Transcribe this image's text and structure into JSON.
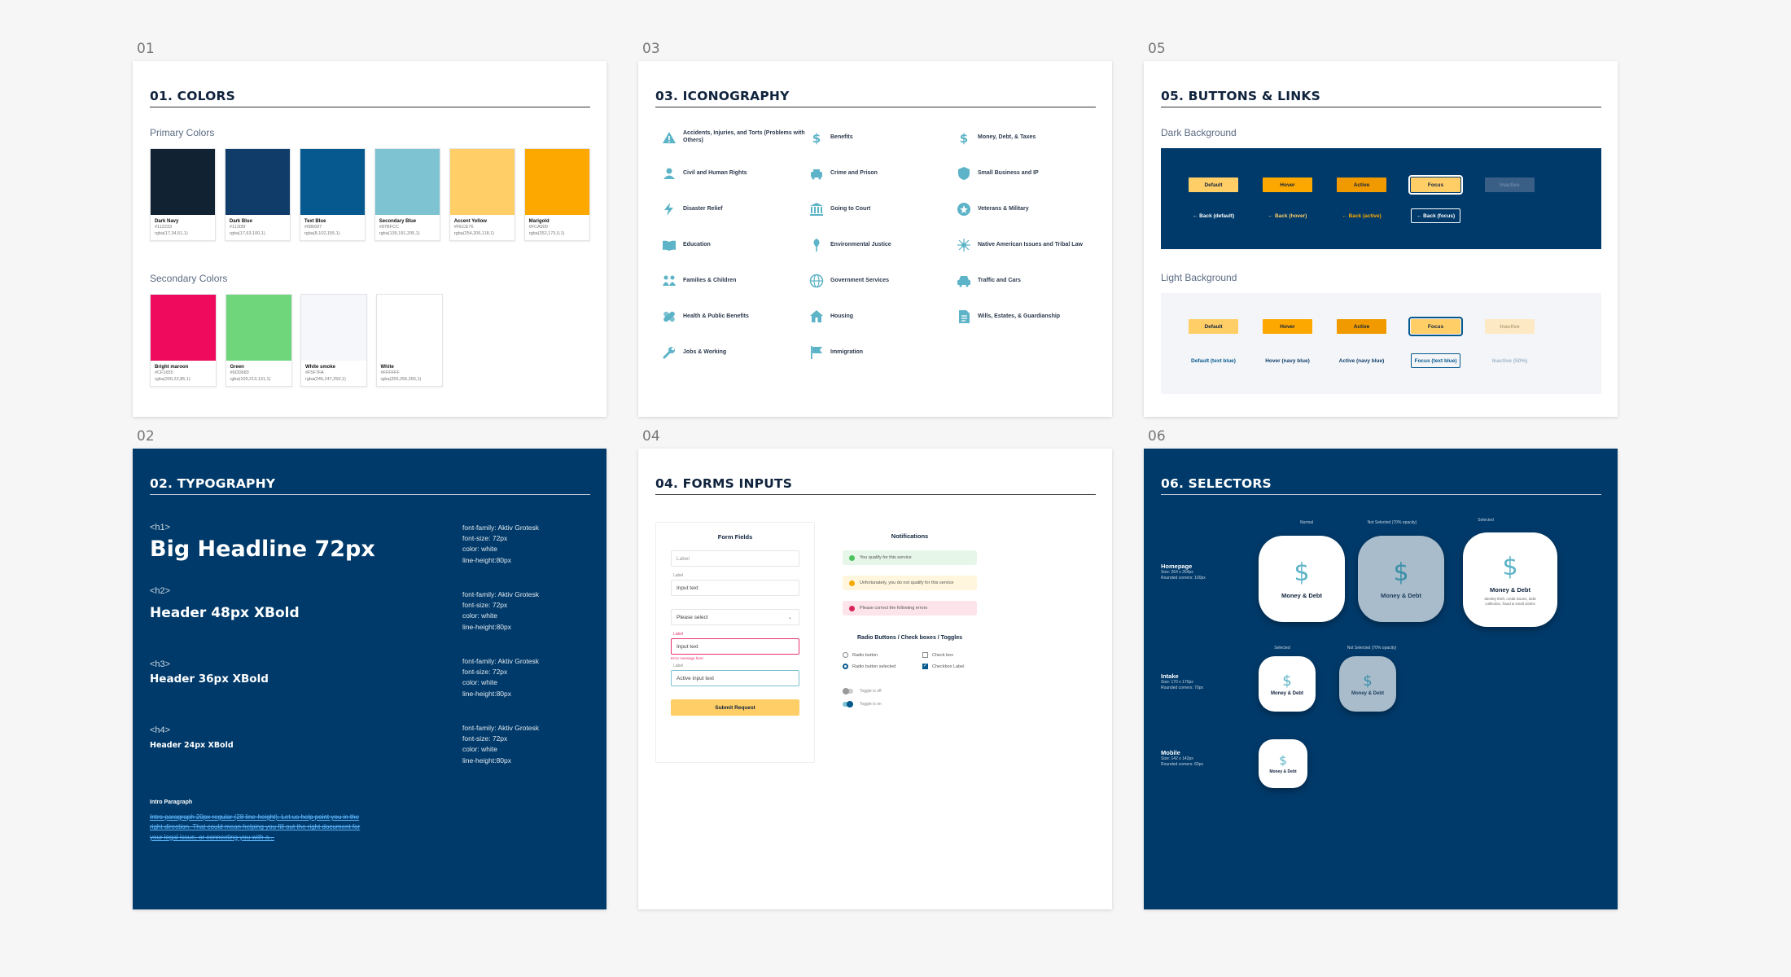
{
  "sections": {
    "colors": {
      "number": "01",
      "title": "01. COLORS",
      "primary_label": "Primary Colors",
      "secondary_label": "Secondary Colors",
      "primary": [
        {
          "name": "Dark Navy",
          "hex": "#112233",
          "rgba": "rgba(17,34,51,1)",
          "color": "#112233"
        },
        {
          "name": "Dark Blue",
          "hex": "#11305f",
          "rgba": "rgba(17,63,100,1)",
          "color": "#0f3c68"
        },
        {
          "name": "Text Blue",
          "hex": "#086697",
          "rgba": "rgba(8,102,155,1)",
          "color": "#05598f"
        },
        {
          "name": "Secondary Blue",
          "hex": "#87BFCC",
          "rgba": "rgba(135,191,205,1)",
          "color": "#7ec3d2"
        },
        {
          "name": "Accent Yellow",
          "hex": "#FECE76",
          "rgba": "rgba(254,206,118,1)",
          "color": "#ffce66"
        },
        {
          "name": "Marigold",
          "hex": "#FCA900",
          "rgba": "rgba(252,173,0,1)",
          "color": "#fda800"
        }
      ],
      "secondary": [
        {
          "name": "Bright maroon",
          "hex": "#CF1655",
          "rgba": "rgba(200,22,85,1)",
          "color": "#ef0a5e"
        },
        {
          "name": "Green",
          "hex": "#6DD683",
          "rgba": "rgba(109,213,131,1)",
          "color": "#70d67c"
        },
        {
          "name": "White smoke",
          "hex": "#F5F7FA",
          "rgba": "rgba(245,247,250,1)",
          "color": "#f5f7fa"
        },
        {
          "name": "White",
          "hex": "#FFFFFF",
          "rgba": "rgba(255,255,255,1)",
          "color": "#ffffff"
        }
      ]
    },
    "typography": {
      "number": "02",
      "title": "02. TYPOGRAPHY",
      "items": [
        {
          "tag": "<h1>",
          "text": "Big Headline 72px",
          "spec": [
            "font-family: Aktiv Grotesk",
            "font-size: 72px",
            "color: white",
            "line-height:80px"
          ]
        },
        {
          "tag": "<h2>",
          "text": "Header 48px XBold",
          "spec": [
            "font-family: Aktiv Grotesk",
            "font-size: 72px",
            "color: white",
            "line-height:80px"
          ]
        },
        {
          "tag": "<h3>",
          "text": "Header 36px XBold",
          "spec": [
            "font-family: Aktiv Grotesk",
            "font-size: 72px",
            "color: white",
            "line-height:80px"
          ]
        },
        {
          "tag": "<h4>",
          "text": "Header 24px XBold",
          "spec": [
            "font-family: Aktiv Grotesk",
            "font-size: 72px",
            "color: white",
            "line-height:80px"
          ]
        }
      ],
      "intro_label": "Intro Paragraph",
      "intro_text": "Intro paragraph 20px regular (28 line-height). Let us help point you in the right direction. That could mean helping you fill out the right document for your legal issue, or connecting you with a..."
    },
    "iconography": {
      "number": "03",
      "title": "03. ICONOGRAPHY",
      "icons": [
        {
          "label": "Accidents, Injuries, and Torts (Problems with Others)",
          "icon": "warning-icon"
        },
        {
          "label": "Benefits",
          "icon": "dollar-icon"
        },
        {
          "label": "Money, Debt, & Taxes",
          "icon": "dollar-icon"
        },
        {
          "label": "Civil and Human Rights",
          "icon": "person-icon"
        },
        {
          "label": "Crime and Prison",
          "icon": "police-car-icon"
        },
        {
          "label": "Small Business and IP",
          "icon": "shield-icon"
        },
        {
          "label": "Disaster Relief",
          "icon": "lightning-icon"
        },
        {
          "label": "Going to Court",
          "icon": "courthouse-icon"
        },
        {
          "label": "Veterans & Military",
          "icon": "star-badge-icon"
        },
        {
          "label": "Education",
          "icon": "book-icon"
        },
        {
          "label": "Environmental Justice",
          "icon": "leaf-icon"
        },
        {
          "label": "Native American Issues and Tribal Law",
          "icon": "dreamcatcher-icon"
        },
        {
          "label": "Families & Children",
          "icon": "family-icon"
        },
        {
          "label": "Government Services",
          "icon": "globe-icon"
        },
        {
          "label": "Traffic and Cars",
          "icon": "car-icon"
        },
        {
          "label": "Health & Public Benefits",
          "icon": "bandage-icon"
        },
        {
          "label": "Housing",
          "icon": "house-icon"
        },
        {
          "label": "Wills, Estates, & Guardianship",
          "icon": "document-icon"
        },
        {
          "label": "Jobs & Working",
          "icon": "wrench-icon"
        },
        {
          "label": "Immigration",
          "icon": "flag-icon"
        }
      ]
    },
    "forms": {
      "number": "04",
      "title": "04. FORMS INPUTS",
      "form_title": "Form Fields",
      "label": "Label",
      "input_text": "Input text",
      "select_placeholder": "Please select",
      "error_message": "Error message here",
      "active_input": "Active input text",
      "submit": "Submit Request",
      "notifications_title": "Notifications",
      "notifications": [
        {
          "text": "You qualify for this service",
          "bg": "#e6f6e8",
          "dot": "#4cc35e"
        },
        {
          "text": "Unfortunately, you do not qualify for this service",
          "bg": "#fff6dd",
          "dot": "#f5a700"
        },
        {
          "text": "Please correct the following errors",
          "bg": "#fde4ea",
          "dot": "#d8245a"
        }
      ],
      "radio_title": "Radio Buttons / Check boxes / Toggles",
      "radio_button": "Radio button",
      "radio_selected": "Radio button selected",
      "check_box": "Check box",
      "checkbox_label": "Checkbox Label",
      "toggle_off": "Toggle is off",
      "toggle_on": "Toggle is on"
    },
    "buttons": {
      "number": "05",
      "title": "05. BUTTONS & LINKS",
      "dark_label": "Dark Background",
      "light_label": "Light Background",
      "dark_buttons": [
        "Default",
        "Hover",
        "Active",
        "Focus",
        "Inactive"
      ],
      "dark_links": [
        "Back (default)",
        "Back (hover)",
        "Back (active)",
        "Back (focus)"
      ],
      "light_buttons": [
        "Default",
        "Hover",
        "Active",
        "Focus",
        "Inactive"
      ],
      "light_links": [
        "Default (text blue)",
        "Hover (navy blue)",
        "Active (navy blue)",
        "Focus (text blue)",
        "Inactive (50%)"
      ]
    },
    "selectors": {
      "number": "06",
      "title": "06. SELECTORS",
      "captions": {
        "normal": "Normal",
        "not_selected": "Not Selected (70% opacity)",
        "selected": "Selected"
      },
      "card_label": "Money & Debt",
      "selected_desc": "Identity theft, credit issues, debt collection, fraud & small claims",
      "rows": [
        {
          "name": "Homepage",
          "size": "Size: 264 x 264px",
          "corners": "Rounded corners: 100px"
        },
        {
          "name": "Intake",
          "size": "Size: 170 x 170px",
          "corners": "Rounded corners: 70px"
        },
        {
          "name": "Mobile",
          "size": "Size: 142 x 142px",
          "corners": "Rounded corners: 60px"
        }
      ]
    }
  }
}
